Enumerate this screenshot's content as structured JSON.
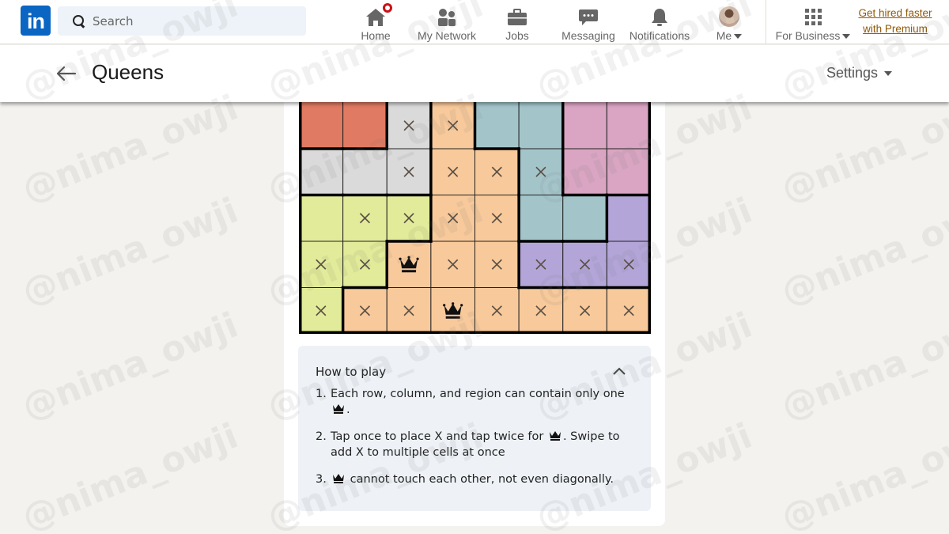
{
  "topnav": {
    "logo_text": "in",
    "search": {
      "placeholder": "Search",
      "value": ""
    },
    "items": [
      {
        "label": "Home",
        "icon": "home-icon",
        "has_notification": true
      },
      {
        "label": "My Network",
        "icon": "people-icon"
      },
      {
        "label": "Jobs",
        "icon": "briefcase-icon"
      },
      {
        "label": "Messaging",
        "icon": "chat-icon"
      },
      {
        "label": "Notifications",
        "icon": "bell-icon"
      },
      {
        "label": "Me",
        "icon": "avatar",
        "has_caret": true
      }
    ],
    "business": {
      "label": "For Business",
      "icon": "apps-grid-icon"
    },
    "premium": {
      "line1": "Get hired faster",
      "line2": "with Premium"
    }
  },
  "subheader": {
    "title": "Queens",
    "settings_label": "Settings"
  },
  "colors": {
    "red": "#e07a62",
    "gray": "#dadada",
    "orange": "#f8c99a",
    "teal": "#a3c5ca",
    "pink": "#d9a5c2",
    "yellow": "#e2eb99",
    "purple": "#b3a5d8",
    "linkedin_blue": "#0a66c2",
    "premium_gold": "#915907",
    "badge_red": "#cc1016"
  },
  "board": {
    "visible_rows": 5,
    "columns": 8,
    "regions": [
      [
        "red",
        "red",
        "gray",
        "orange",
        "teal",
        "teal",
        "pink",
        "pink"
      ],
      [
        "gray",
        "gray",
        "gray",
        "orange",
        "orange",
        "teal",
        "pink",
        "pink"
      ],
      [
        "yellow",
        "yellow",
        "yellow",
        "orange",
        "orange",
        "teal",
        "teal",
        "purple"
      ],
      [
        "yellow",
        "yellow",
        "orange",
        "orange",
        "orange",
        "purple",
        "purple",
        "purple"
      ],
      [
        "yellow",
        "orange",
        "orange",
        "orange",
        "orange",
        "orange",
        "orange",
        "orange"
      ]
    ],
    "marks": [
      [
        "",
        "",
        "X",
        "X",
        "",
        "",
        "",
        ""
      ],
      [
        "",
        "",
        "X",
        "X",
        "X",
        "X",
        "",
        ""
      ],
      [
        "",
        "X",
        "X",
        "X",
        "X",
        "",
        "",
        ""
      ],
      [
        "X",
        "X",
        "Q",
        "X",
        "X",
        "X",
        "X",
        "X"
      ],
      [
        "X",
        "X",
        "X",
        "Q",
        "X",
        "X",
        "X",
        "X"
      ]
    ]
  },
  "howto": {
    "title": "How to play",
    "rules": [
      {
        "num": "1.",
        "before": "Each row, column, and region can contain only one",
        "after": "."
      },
      {
        "num": "2.",
        "before": "Tap once to place X and tap twice for",
        "after": ". Swipe to add X to multiple cells at once"
      },
      {
        "num": "3.",
        "before": "",
        "after": "cannot touch each other, not even diagonally."
      }
    ]
  },
  "watermark": "@nima_owji"
}
